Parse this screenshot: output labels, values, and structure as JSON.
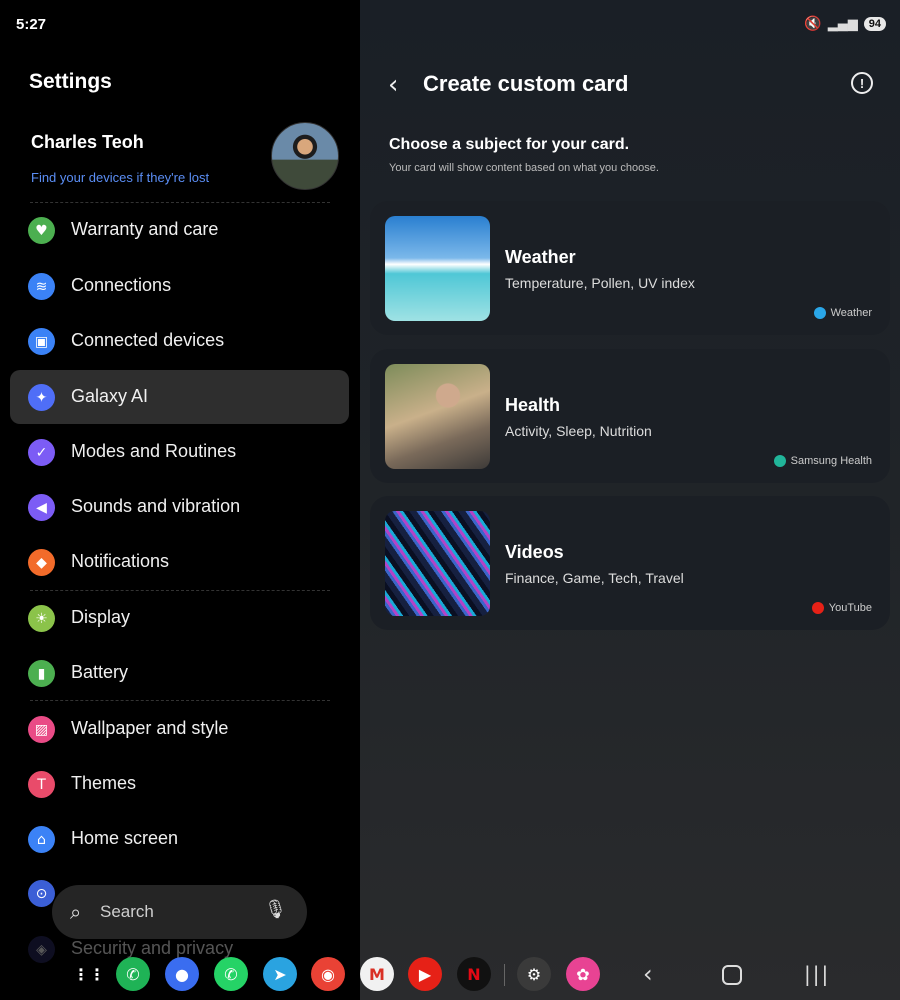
{
  "status": {
    "time": "5:27",
    "battery": "94"
  },
  "left": {
    "title": "Settings",
    "profile": {
      "name": "Charles Teoh",
      "link": "Find your devices if they're lost"
    },
    "items": [
      {
        "label": "Warranty and care",
        "icon": "heart-shield-icon",
        "color": "#4caf50",
        "glyph": "♥"
      },
      {
        "label": "Connections",
        "icon": "wifi-icon",
        "color": "#3b82f6",
        "glyph": "≋"
      },
      {
        "label": "Connected devices",
        "icon": "devices-icon",
        "color": "#3b82f6",
        "glyph": "▣"
      },
      {
        "label": "Galaxy AI",
        "icon": "sparkle-icon",
        "color": "#4f6ef7",
        "glyph": "✦"
      },
      {
        "label": "Modes and Routines",
        "icon": "check-circle-icon",
        "color": "#7c5cf5",
        "glyph": "✓"
      },
      {
        "label": "Sounds and vibration",
        "icon": "speaker-icon",
        "color": "#7c5cf5",
        "glyph": "◀"
      },
      {
        "label": "Notifications",
        "icon": "bell-icon",
        "color": "#f26b2a",
        "glyph": "◆"
      },
      {
        "label": "Display",
        "icon": "sun-icon",
        "color": "#8bc34a",
        "glyph": "☀"
      },
      {
        "label": "Battery",
        "icon": "battery-icon",
        "color": "#4caf50",
        "glyph": "▮"
      },
      {
        "label": "Wallpaper and style",
        "icon": "image-icon",
        "color": "#e94b86",
        "glyph": "▨"
      },
      {
        "label": "Themes",
        "icon": "brush-icon",
        "color": "#e94b6a",
        "glyph": "T"
      },
      {
        "label": "Home screen",
        "icon": "home-icon",
        "color": "#3b82f6",
        "glyph": "⌂"
      },
      {
        "label": "",
        "icon": "lock-icon",
        "color": "#3b5fd6",
        "glyph": "⊙"
      },
      {
        "label": "Security and privacy",
        "icon": "shield-icon",
        "color": "#2a2a5e",
        "glyph": "◈"
      }
    ],
    "search": {
      "label": "Search"
    }
  },
  "right": {
    "title": "Create custom card",
    "heading": "Choose a subject for your card.",
    "description": "Your card will show content based on what you choose.",
    "cards": [
      {
        "title": "Weather",
        "subtitle": "Temperature, Pollen, UV index",
        "source": "Weather",
        "source_color": "#2aa6e8"
      },
      {
        "title": "Health",
        "subtitle": "Activity, Sleep, Nutrition",
        "source": "Samsung Health",
        "source_color": "#21b59a"
      },
      {
        "title": "Videos",
        "subtitle": "Finance, Game, Tech, Travel",
        "source": "YouTube",
        "source_color": "#e62117"
      }
    ]
  },
  "dock": {
    "apps": [
      {
        "name": "apps-grid-icon",
        "color": "transparent",
        "glyph": "⋮⋮"
      },
      {
        "name": "phone-app-icon",
        "color": "#1fb356",
        "glyph": "✆"
      },
      {
        "name": "messages-app-icon",
        "color": "#3a6df0",
        "glyph": "●"
      },
      {
        "name": "whatsapp-app-icon",
        "color": "#25d366",
        "glyph": "✆"
      },
      {
        "name": "telegram-app-icon",
        "color": "#2aa3e0",
        "glyph": "➤"
      },
      {
        "name": "chrome-app-icon",
        "color": "#e94235",
        "glyph": "◉"
      },
      {
        "name": "gmail-app-icon",
        "color": "#f1f1f1",
        "glyph": "M"
      },
      {
        "name": "youtube-app-icon",
        "color": "#e62117",
        "glyph": "▶"
      },
      {
        "name": "netflix-app-icon",
        "color": "#111111",
        "glyph": "N"
      },
      {
        "name": "settings-app-icon",
        "color": "#3a3a3a",
        "glyph": "⚙"
      },
      {
        "name": "gallery-app-icon",
        "color": "#e84393",
        "glyph": "✿"
      }
    ]
  }
}
